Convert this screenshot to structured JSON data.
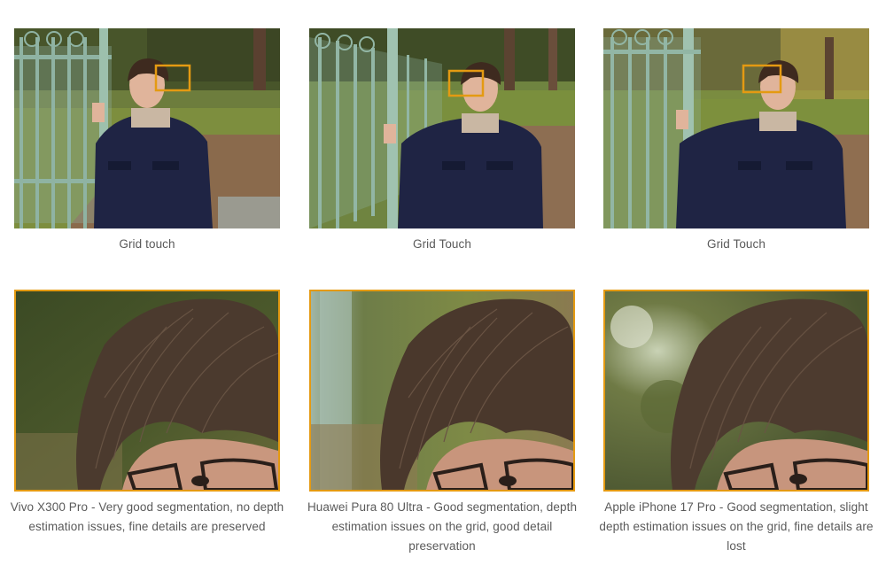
{
  "gallery": {
    "full_shots": [
      {
        "caption": "Grid touch"
      },
      {
        "caption": "Grid Touch"
      },
      {
        "caption": "Grid Touch"
      }
    ],
    "crops": [
      {
        "caption": "Vivo X300 Pro - Very good segmentation, no depth estimation issues, fine details are preserved"
      },
      {
        "caption": "Huawei Pura 80 Ultra - Good segmentation, depth estimation issues on the grid, good detail preservation"
      },
      {
        "caption": "Apple iPhone 17 Pro - Good segmentation, slight depth estimation issues on the grid, fine details are lost"
      }
    ],
    "colors": {
      "highlight_box": "#e49a12",
      "caption_text": "#5a5a5a"
    }
  }
}
